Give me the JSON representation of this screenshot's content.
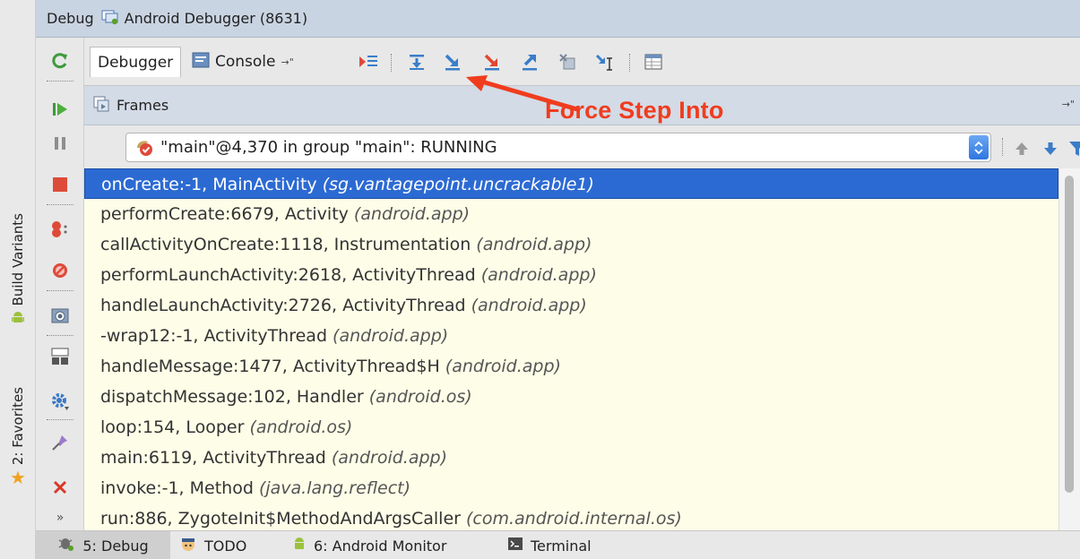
{
  "left_stripe": {
    "build_variants_label": "Build Variants",
    "favorites_label": "2: Favorites"
  },
  "debug_window": {
    "title": "Debug",
    "session": "Android Debugger (8631)"
  },
  "tabs": {
    "debugger": "Debugger",
    "console": "Console",
    "console_pin": "→\""
  },
  "frames_panel": {
    "title": "Frames",
    "pin": "→\""
  },
  "annotation": "Force Step Into",
  "thread_selector": {
    "selected": "\"main\"@4,370 in group \"main\": RUNNING"
  },
  "frames": [
    {
      "method": "onCreate:-1, MainActivity ",
      "pkg": "(sg.vantagepoint.uncrackable1)"
    },
    {
      "method": "performCreate:6679, Activity ",
      "pkg": "(android.app)"
    },
    {
      "method": "callActivityOnCreate:1118, Instrumentation ",
      "pkg": "(android.app)"
    },
    {
      "method": "performLaunchActivity:2618, ActivityThread ",
      "pkg": "(android.app)"
    },
    {
      "method": "handleLaunchActivity:2726, ActivityThread ",
      "pkg": "(android.app)"
    },
    {
      "method": "-wrap12:-1, ActivityThread ",
      "pkg": "(android.app)"
    },
    {
      "method": "handleMessage:1477, ActivityThread$H ",
      "pkg": "(android.app)"
    },
    {
      "method": "dispatchMessage:102, Handler ",
      "pkg": "(android.os)"
    },
    {
      "method": "loop:154, Looper ",
      "pkg": "(android.os)"
    },
    {
      "method": "main:6119, ActivityThread ",
      "pkg": "(android.app)"
    },
    {
      "method": "invoke:-1, Method ",
      "pkg": "(java.lang.reflect)"
    },
    {
      "method": "run:886, ZygoteInit$MethodAndArgsCaller ",
      "pkg": "(com.android.internal.os)"
    }
  ],
  "statusbar": {
    "debug": "5: Debug",
    "todo": "TODO",
    "android_monitor": "6: Android Monitor",
    "terminal": "Terminal"
  },
  "more_glyph": "»",
  "colors": {
    "selection": "#2c6ad3",
    "frames_bg": "#fdfde8",
    "annotation": "#f03c1e",
    "header_blue": "#c9d4e2"
  }
}
